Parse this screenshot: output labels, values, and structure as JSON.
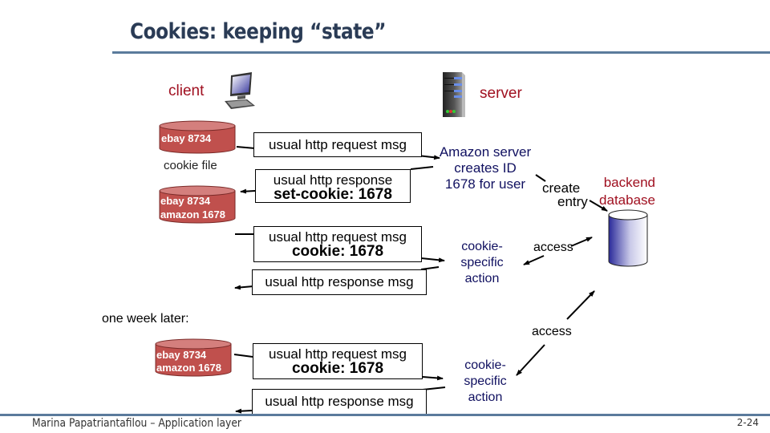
{
  "slide": {
    "title": "Cookies: keeping “state”",
    "footer": "Marina Papatriantafilou –  Application layer",
    "page_number": "2-24"
  },
  "labels": {
    "client": "client",
    "server": "server",
    "cookie_file": "cookie file",
    "one_week_later": "one week later:",
    "backend_line1": "backend",
    "backend_line2": "database",
    "create": "create",
    "entry": "entry",
    "access1": "access",
    "access2": "access"
  },
  "server_note": {
    "line1": "Amazon server",
    "line2": "creates ID",
    "line3": "1678 for user"
  },
  "cookie_action_1": {
    "line1": "cookie-",
    "line2": "specific",
    "line3": "action"
  },
  "cookie_action_2": {
    "line1": "cookie-",
    "line2": "specific",
    "line3": "action"
  },
  "cookie_files": {
    "first": [
      "ebay 8734"
    ],
    "second": [
      "ebay 8734",
      "amazon 1678"
    ],
    "third": [
      "ebay 8734",
      "amazon 1678"
    ]
  },
  "messages": {
    "m1": {
      "line1": "usual http request msg"
    },
    "m2": {
      "line1": "usual http response",
      "line2": "set-cookie: 1678"
    },
    "m3": {
      "line1": "usual http request msg",
      "line2": "cookie: 1678"
    },
    "m4": {
      "line1": "usual http response msg"
    },
    "m5": {
      "line1": "usual http request msg",
      "line2": "cookie: 1678"
    },
    "m6": {
      "line1": "usual http response msg"
    }
  },
  "icons": {
    "client": "desktop-computer-icon",
    "server": "server-tower-icon",
    "database": "database-cylinder-icon"
  }
}
